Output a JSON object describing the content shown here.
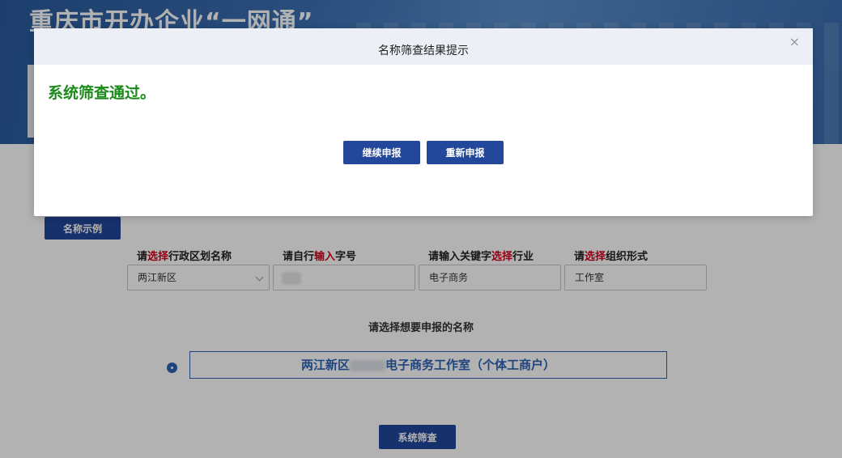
{
  "header": {
    "title": "重庆市开办企业“一网通”"
  },
  "form": {
    "example_button": "名称示例",
    "labels": {
      "district": {
        "pre": "请",
        "hl": "选择",
        "post": "行政区划名称"
      },
      "tradename": {
        "pre": "请自行",
        "hl": "输入",
        "post": "字号"
      },
      "industry": {
        "pre": "请输入关键字",
        "hl": "选择",
        "post": "行业"
      },
      "org_form": {
        "pre": "请",
        "hl": "选择",
        "post": "组织形式"
      }
    },
    "values": {
      "district": "两江新区",
      "tradename": "",
      "industry": "电子商务",
      "org_form": "工作室"
    },
    "choose_title": "请选择想要申报的名称",
    "option": {
      "prefix": "两江新区",
      "suffix": "电子商务工作室（个体工商户）"
    },
    "screen_button": "系统筛查"
  },
  "modal": {
    "title": "名称筛查结果提示",
    "close": "×",
    "message": "系统筛查通过。",
    "continue_button": "继续申报",
    "reapply_button": "重新申报"
  },
  "colors": {
    "primary": "#22479b",
    "success_text": "#1a8a1a",
    "highlight": "#d0021b",
    "option_blue": "#2e63b4"
  }
}
